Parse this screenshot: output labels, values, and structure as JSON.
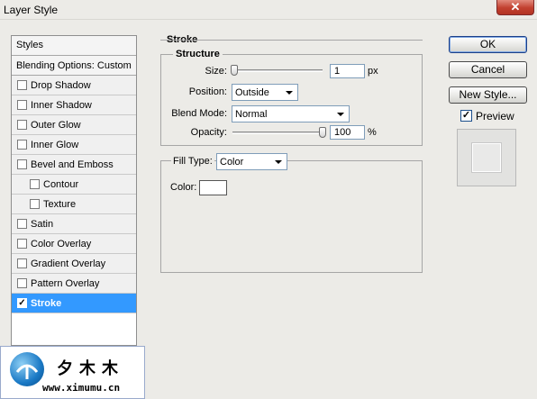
{
  "window": {
    "title": "Layer Style",
    "close_glyph": "✕"
  },
  "styles_panel": {
    "header": "Styles",
    "blending_options": "Blending Options: Custom",
    "items": [
      {
        "label": "Drop Shadow",
        "checked": false
      },
      {
        "label": "Inner Shadow",
        "checked": false
      },
      {
        "label": "Outer Glow",
        "checked": false
      },
      {
        "label": "Inner Glow",
        "checked": false
      },
      {
        "label": "Bevel and Emboss",
        "checked": false
      },
      {
        "label": "Contour",
        "checked": false,
        "indent": true
      },
      {
        "label": "Texture",
        "checked": false,
        "indent": true
      },
      {
        "label": "Satin",
        "checked": false
      },
      {
        "label": "Color Overlay",
        "checked": false
      },
      {
        "label": "Gradient Overlay",
        "checked": false
      },
      {
        "label": "Pattern Overlay",
        "checked": false
      },
      {
        "label": "Stroke",
        "checked": true,
        "selected": true
      }
    ]
  },
  "stroke": {
    "section_title": "Stroke",
    "structure_title": "Structure",
    "size_label": "Size:",
    "size_value": "1",
    "size_unit": "px",
    "size_slider_fraction": 0.0,
    "position_label": "Position:",
    "position_value": "Outside",
    "blend_mode_label": "Blend Mode:",
    "blend_mode_value": "Normal",
    "opacity_label": "Opacity:",
    "opacity_value": "100",
    "opacity_unit": "%",
    "opacity_slider_fraction": 1.0,
    "fill_type_label": "Fill Type:",
    "fill_type_value": "Color",
    "color_label": "Color:",
    "stroke_color": "#ffffff"
  },
  "buttons": {
    "ok": "OK",
    "cancel": "Cancel",
    "new_style": "New Style..."
  },
  "preview": {
    "label": "Preview",
    "checked": true,
    "check_glyph": "✓"
  },
  "watermark": {
    "chinese_text": "夕木木",
    "url": "www.ximumu.cn"
  },
  "colors": {
    "selection": "#3399ff",
    "close_button": "#c1402f"
  }
}
